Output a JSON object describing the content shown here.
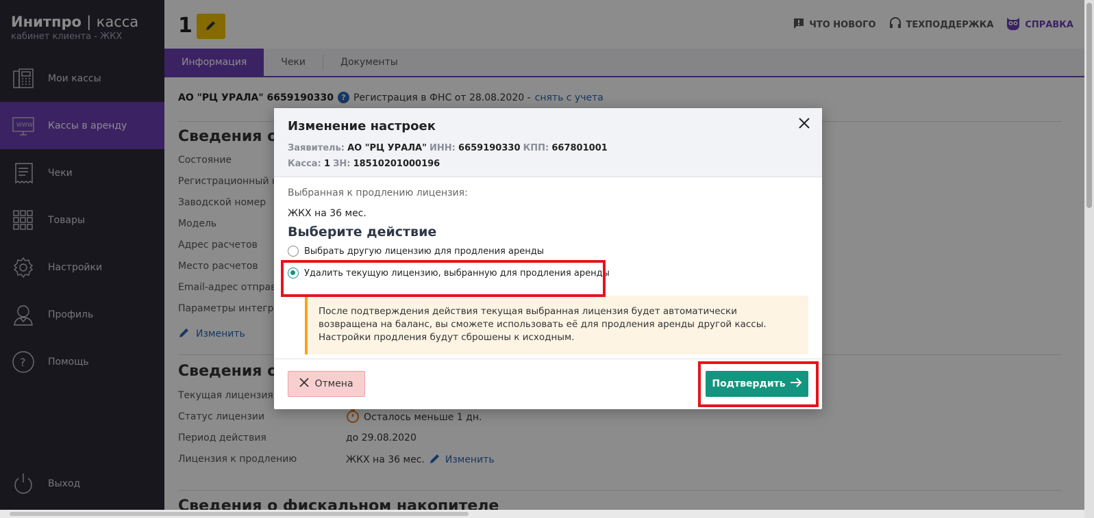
{
  "brand": {
    "name": "Инитпро",
    "separator": "|",
    "product": "касса",
    "subtitle": "кабинет клиента - ЖКХ"
  },
  "sidebar": {
    "items": [
      {
        "label": "Мои кассы",
        "icon": "cash-register-icon"
      },
      {
        "label": "Кассы в аренду",
        "icon": "monitor-www-icon",
        "active": true
      },
      {
        "label": "Чеки",
        "icon": "receipt-icon"
      },
      {
        "label": "Товары",
        "icon": "grid-icon"
      },
      {
        "label": "Настройки",
        "icon": "gear-icon"
      },
      {
        "label": "Профиль",
        "icon": "user-icon"
      },
      {
        "label": "Помощь",
        "icon": "help-circle-icon"
      }
    ],
    "logout": "Выход"
  },
  "header": {
    "kassa_number": "1",
    "links": {
      "news": "ЧТО НОВОГО",
      "support": "ТЕХПОДДЕРЖКА",
      "help": "СПРАВКА"
    }
  },
  "tabs": [
    "Информация",
    "Чеки",
    "Документы"
  ],
  "infoline": {
    "org": "АО \"РЦ УРАЛА\" 6659190330",
    "registration": "Регистрация в ФНС от 28.08.2020 -",
    "unregister_link": "снять с учета"
  },
  "section1": {
    "title": "Сведения о к",
    "rows": [
      "Состояние",
      "Регистрационный но",
      "Заводской номер",
      "Модель",
      "Адрес расчетов",
      "Место расчетов",
      "Email-адрес отправи"
    ],
    "integration_link": "Параметры интеграц",
    "edit_link": "Изменить"
  },
  "section2": {
    "title": "Сведения о л",
    "rows": [
      {
        "label": "Текущая лицензия",
        "value": ""
      },
      {
        "label": "Статус лицензии",
        "value": "Осталось меньше 1 дн."
      },
      {
        "label": "Период действия",
        "value": "до 29.08.2020"
      },
      {
        "label": "Лицензия к продлению",
        "value": "ЖКХ на 36 мес.",
        "link": "Изменить"
      }
    ]
  },
  "section3": {
    "title": "Сведения о фискальном накопителе"
  },
  "modal": {
    "title": "Изменение настроек",
    "applicant_label": "Заявитель:",
    "applicant_value": "АО \"РЦ УРАЛА\"",
    "inn_label": "ИНН:",
    "inn_value": "6659190330",
    "kpp_label": "КПП:",
    "kpp_value": "667801001",
    "kassa_label": "Касса:",
    "kassa_value": "1",
    "zn_label": "ЗН:",
    "zn_value": "18510201000196",
    "selected_license_label": "Выбранная к продлению лицензия:",
    "selected_license_value": "ЖКХ на 36 мес.",
    "choose_action": "Выберите действие",
    "option1": "Выбрать другую лицензию для продления аренды",
    "option2": "Удалить текущую лицензию, выбранную для продления аренды",
    "notice": "После подтверждения действия текущая выбранная лицензия будет автоматически возвращена на баланс, вы сможете использовать её для продления аренды другой кассы. Настройки продления будут сброшены к исходным.",
    "cancel": "Отмена",
    "confirm": "Подтвердить"
  },
  "colors": {
    "accent": "#6c3fb5",
    "confirm": "#14957f",
    "highlight": "#e3151b"
  }
}
